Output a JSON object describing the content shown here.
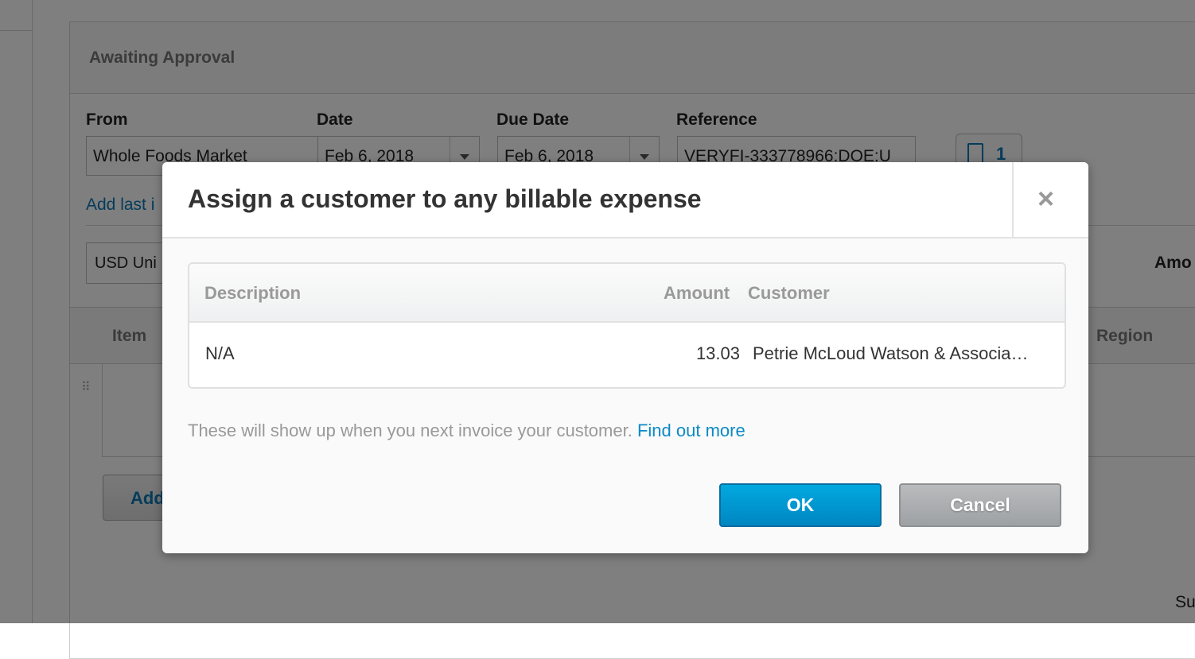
{
  "background": {
    "panel_title": "Awaiting Approval",
    "labels": {
      "from": "From",
      "date": "Date",
      "due_date": "Due Date",
      "reference": "Reference"
    },
    "fields": {
      "from": "Whole Foods Market",
      "date": "Feb 6, 2018",
      "due_date": "Feb 6, 2018",
      "reference": "VERYFI-333778966:DOE:U"
    },
    "attachments_count": "1",
    "add_last_link": "Add last i",
    "currency": "USD Uni",
    "amount_header": "Amo",
    "table_headers": {
      "item": "Item",
      "region": "Region"
    },
    "add_button": "Add",
    "subtotal_label": "Su"
  },
  "modal": {
    "title": "Assign a customer to any billable expense",
    "close_label": "×",
    "table": {
      "headers": {
        "description": "Description",
        "amount": "Amount",
        "customer": "Customer"
      },
      "rows": [
        {
          "description": "N/A",
          "amount": "13.03",
          "customer": "Petrie McLoud Watson & Associa…"
        }
      ]
    },
    "note": "These will show up when you next invoice your customer.",
    "note_link": "Find out more",
    "ok_label": "OK",
    "cancel_label": "Cancel"
  },
  "colors": {
    "primary": "#0086c1",
    "link": "#0b8ac7",
    "overlay": "rgba(0,0,0,0.5)"
  }
}
